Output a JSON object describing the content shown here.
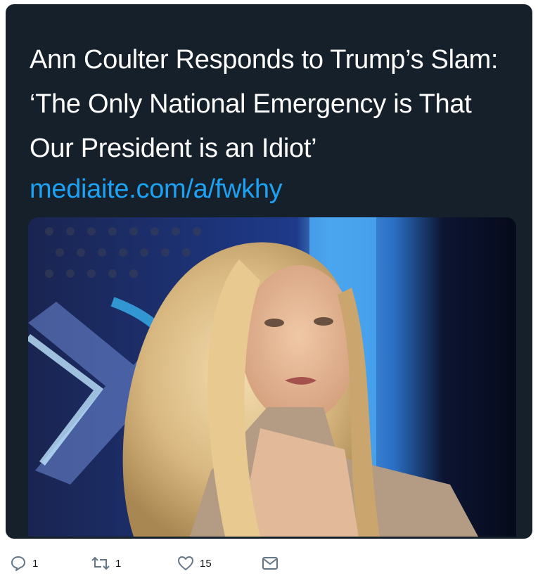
{
  "tweet_card": {
    "headline": "Ann Coulter Responds to Trump’s Slam: ‘The Only National Emergency is That Our President is an Idiot’",
    "link": "mediaite.com/a/fwkhy"
  },
  "image": {
    "subject": "woman-with-long-blonde-hair"
  },
  "actions": {
    "reply_count": "1",
    "retweet_count": "1",
    "like_count": "15",
    "icons": [
      "reply-icon",
      "retweet-icon",
      "like-icon",
      "message-icon"
    ]
  },
  "colors": {
    "card_background": "#15202b",
    "link": "#1da1f2",
    "action_icon": "#657786"
  }
}
